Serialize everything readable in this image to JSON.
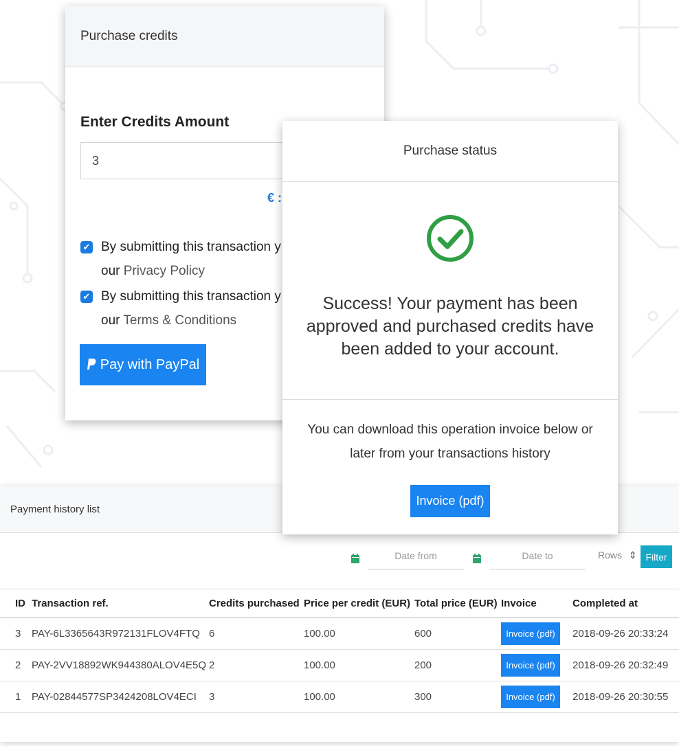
{
  "purchase": {
    "title": "Purchase credits",
    "amount_label": "Enter Credits Amount",
    "amount_value": "3",
    "price_hint": "€ :",
    "checks": [
      {
        "text": "By submitting this transaction y",
        "line2": "our ",
        "link": "Privacy Policy"
      },
      {
        "text": "By submitting this transaction y",
        "line2": "our ",
        "link": "Terms & Conditions"
      }
    ],
    "paypal_label": "Pay with PayPal"
  },
  "status": {
    "title": "Purchase status",
    "message": "Success! Your payment has been approved and purchased credits have been added to your account.",
    "download": "You can download this operation invoice below or later from your transactions history",
    "invoice_label": "Invoice (pdf)"
  },
  "history": {
    "title": "Payment history list",
    "date_from": "Date from",
    "date_to": "Date to",
    "rows_label": "Rows",
    "filter_label": "Filter",
    "headers": [
      "ID",
      "Transaction ref.",
      "Credits purchased",
      "Price per credit (EUR)",
      "Total price (EUR)",
      "Invoice",
      "Completed at"
    ],
    "rows": [
      {
        "id": "3",
        "ref": "PAY-6L3365643R972131FLOV4FTQ",
        "credits": "6",
        "price": "100.00",
        "total": "600",
        "invoice": "Invoice (pdf)",
        "completed": "2018-09-26 20:33:24"
      },
      {
        "id": "2",
        "ref": "PAY-2VV18892WK944380ALOV4E5Q",
        "credits": "2",
        "price": "100.00",
        "total": "200",
        "invoice": "Invoice (pdf)",
        "completed": "2018-09-26 20:32:49"
      },
      {
        "id": "1",
        "ref": "PAY-02844577SP3424208LOV4ECI",
        "credits": "3",
        "price": "100.00",
        "total": "300",
        "invoice": "Invoice (pdf)",
        "completed": "2018-09-26 20:30:55"
      }
    ]
  },
  "colors": {
    "accent": "#1a84f0",
    "success": "#2f9e44",
    "filter": "#15a8c7"
  }
}
